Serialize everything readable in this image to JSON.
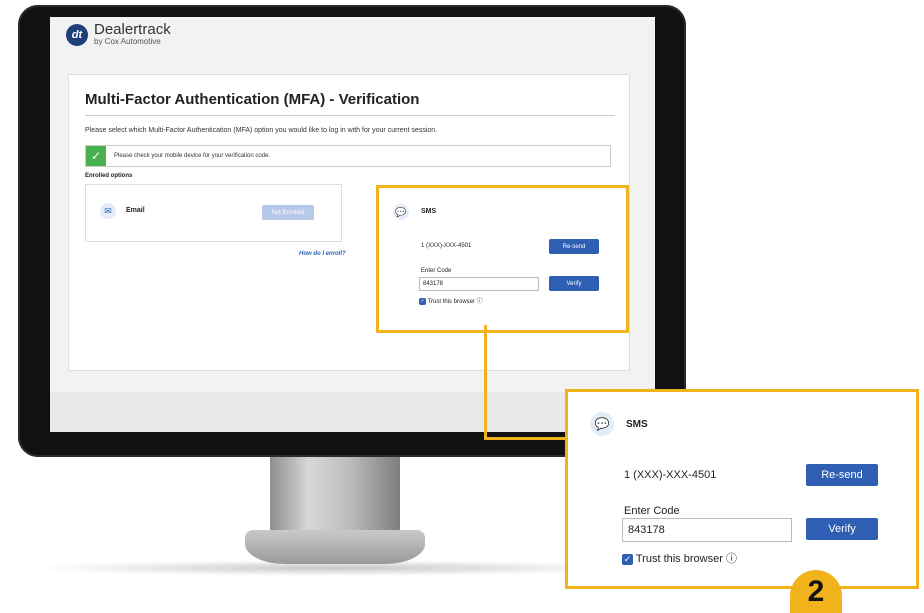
{
  "brand": {
    "name": "Dealertrack",
    "subtitle": "by Cox Automotive",
    "logo_text": "dt"
  },
  "page": {
    "title": "Multi-Factor Authentication (MFA) - Verification",
    "intro": "Please select which Multi-Factor Authentication (MFA) option you would like to log in with for your current session.",
    "notice": "Please check your mobile device for your verification code.",
    "enrolled_label": "Enrolled options"
  },
  "options": {
    "email": {
      "name": "Email",
      "status_button": "Not Enrolled",
      "icon": "mail-icon"
    },
    "enroll_link": "How do I enroll?"
  },
  "sms": {
    "name": "SMS",
    "phone": "1 (XXX)-XXX-4501",
    "resend_label": "Re-send",
    "code_label": "Enter Code",
    "code_value": "843178",
    "verify_label": "Verify",
    "trust_label": "Trust this browser",
    "trust_checked": true,
    "icon": "chat-bubble-icon"
  },
  "callout": {
    "step_number": "2"
  },
  "colors": {
    "accent": "#f2b21b",
    "primary_button": "#2f5fb3",
    "success": "#4caf50"
  }
}
